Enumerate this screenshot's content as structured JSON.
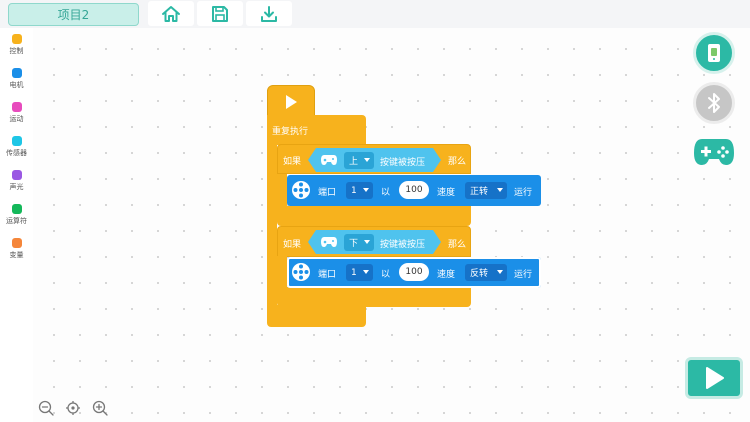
{
  "topbar": {
    "project_name": "项目2",
    "home_icon": "home-icon",
    "save_icon": "save-icon",
    "download_icon": "download-icon"
  },
  "sidebar": {
    "categories": [
      {
        "label": "控制",
        "color": "#f7b21d"
      },
      {
        "label": "电机",
        "color": "#1b8fe8"
      },
      {
        "label": "运动",
        "color": "#e74bbd"
      },
      {
        "label": "传感器",
        "color": "#1ec6e6"
      },
      {
        "label": "声光",
        "color": "#9a58e3"
      },
      {
        "label": "运算符",
        "color": "#14b85a"
      },
      {
        "label": "变量",
        "color": "#f5863a"
      }
    ]
  },
  "script": {
    "forever_label": "重复执行",
    "if_blocks": [
      {
        "if_label": "如果",
        "key_value": "上",
        "pressed_label": "按键被按压",
        "then_label": "那么",
        "motor": {
          "port_label": "端口",
          "port_value": "1",
          "with_label": "以",
          "speed_value": "100",
          "speed_label": "速度",
          "direction_value": "正转",
          "run_label": "运行"
        }
      },
      {
        "if_label": "如果",
        "key_value": "下",
        "pressed_label": "按键被按压",
        "then_label": "那么",
        "motor": {
          "port_label": "端口",
          "port_value": "1",
          "with_label": "以",
          "speed_value": "100",
          "speed_label": "速度",
          "direction_value": "反转",
          "run_label": "运行"
        }
      }
    ]
  },
  "colors": {
    "control": "#f7b21d",
    "motor": "#1b8fe8",
    "sensor": "#4fc3ee",
    "accent": "#2cb9a5"
  },
  "right_panel": {
    "device_icon": "device-icon",
    "bluetooth_icon": "bluetooth-icon",
    "gamepad_icon": "gamepad-icon",
    "run_icon": "play-icon"
  },
  "zoom": {
    "zoom_out_icon": "zoom-out-icon",
    "center_icon": "recenter-icon",
    "zoom_in_icon": "zoom-in-icon"
  }
}
